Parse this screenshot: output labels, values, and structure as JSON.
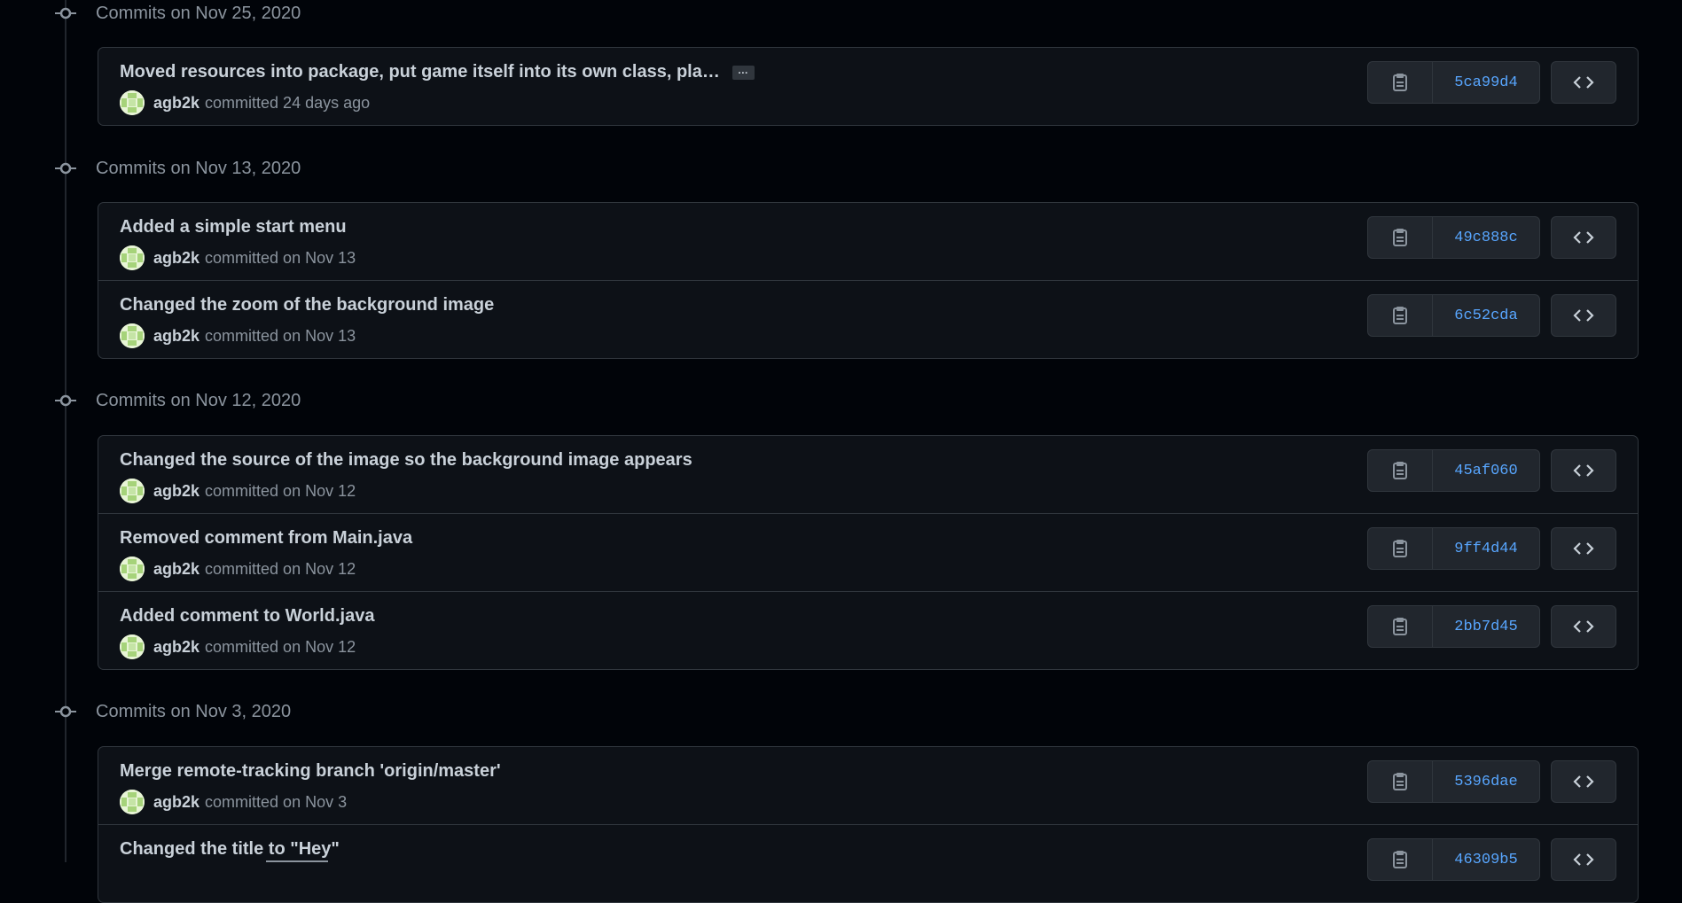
{
  "groups": [
    {
      "title": "Commits on Nov 25, 2020",
      "commits": [
        {
          "message": "Moved resources into package, put game itself into its own class, pla…",
          "has_more": true,
          "ellipsis": "…",
          "author": "agb2k",
          "committed": "committed 24 days ago",
          "sha": "5ca99d4"
        }
      ]
    },
    {
      "title": "Commits on Nov 13, 2020",
      "commits": [
        {
          "message": "Added a simple start menu",
          "author": "agb2k",
          "committed": "committed on Nov 13",
          "sha": "49c888c"
        },
        {
          "message": "Changed the zoom of the background image",
          "author": "agb2k",
          "committed": "committed on Nov 13",
          "sha": "6c52cda"
        }
      ]
    },
    {
      "title": "Commits on Nov 12, 2020",
      "commits": [
        {
          "message": "Changed the source of the image so the background image appears",
          "author": "agb2k",
          "committed": "committed on Nov 12",
          "sha": "45af060"
        },
        {
          "message": "Removed comment from Main.java",
          "author": "agb2k",
          "committed": "committed on Nov 12",
          "sha": "9ff4d44"
        },
        {
          "message": "Added comment to World.java",
          "author": "agb2k",
          "committed": "committed on Nov 12",
          "sha": "2bb7d45"
        }
      ]
    },
    {
      "title": "Commits on Nov 3, 2020",
      "commits": [
        {
          "message": "Merge remote-tracking branch 'origin/master'",
          "author": "agb2k",
          "committed": "committed on Nov 3",
          "sha": "5396dae"
        },
        {
          "message": "Changed the title to \"Hey\"",
          "author": "",
          "committed": "",
          "sha": "46309b5"
        }
      ]
    }
  ],
  "icons": {
    "commit_node": "git-commit-icon",
    "copy": "clipboard-icon",
    "browse": "code-icon"
  },
  "colors": {
    "background": "#010409",
    "box": "#0d1117",
    "border": "#30363d",
    "sha_link": "#58a6ff",
    "text": "#c9d1d9",
    "muted": "#8b949e"
  }
}
